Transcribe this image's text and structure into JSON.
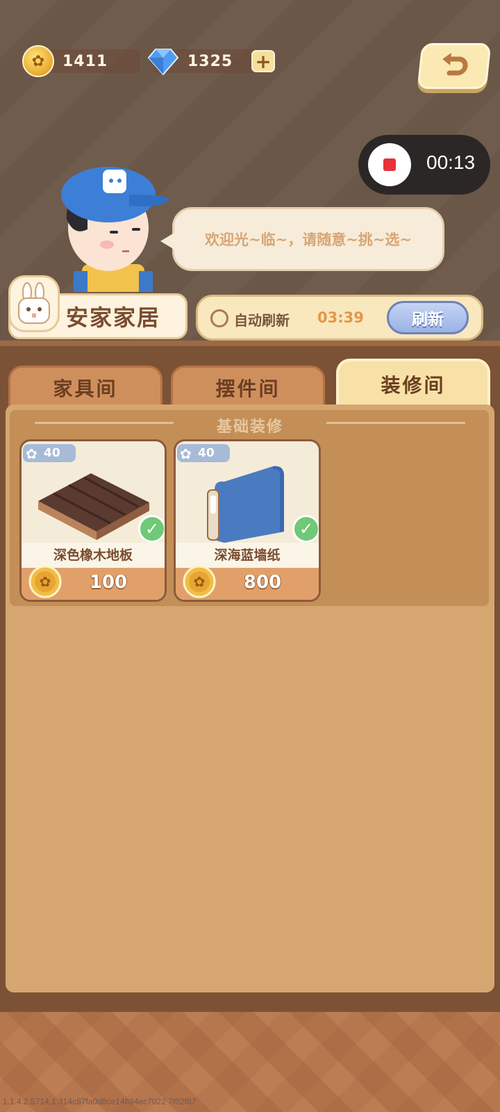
{
  "header": {
    "coins": "1411",
    "diamonds": "1325"
  },
  "screen_recorder": {
    "time": "00:13"
  },
  "shopkeeper": {
    "greeting": "欢迎光~临~，请随意~挑~选~"
  },
  "shop": {
    "name": "安家家居",
    "auto_refresh_label": "自动刷新",
    "countdown": "03:39",
    "refresh_button": "刷新"
  },
  "tabs": [
    {
      "label": "家具间",
      "active": false
    },
    {
      "label": "摆件间",
      "active": false
    },
    {
      "label": "装修间",
      "active": true
    }
  ],
  "category": {
    "title": "基础装修"
  },
  "items": [
    {
      "level": "40",
      "name": "深色橡木地板",
      "price": "100",
      "owned": true
    },
    {
      "level": "40",
      "name": "深海蓝墙纸",
      "price": "800",
      "owned": true
    }
  ],
  "footer": {
    "build": "1.1.4.2.5714.1.314c87fa0d8ce14694ec7022 7f02f87"
  },
  "colors": {
    "panel": "#d5a670",
    "active_tab": "#f8e1a6",
    "inactive_tab": "#cf8f5c",
    "refresh_button": "#9bb2e6",
    "check": "#6fc977"
  }
}
